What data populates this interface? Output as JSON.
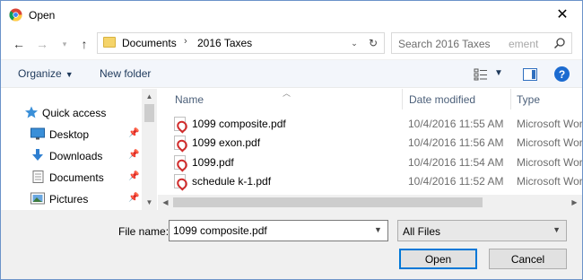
{
  "window": {
    "title": "Open"
  },
  "address": {
    "crumbs": [
      "Documents",
      "2016 Taxes"
    ]
  },
  "search": {
    "placeholder": "Search 2016 Taxes",
    "ghost_text": "ement"
  },
  "toolbar": {
    "organize_label": "Organize",
    "new_folder_label": "New folder"
  },
  "nav": {
    "items": [
      {
        "label": "Quick access",
        "icon": "star-icon"
      },
      {
        "label": "Desktop",
        "icon": "desktop-icon"
      },
      {
        "label": "Downloads",
        "icon": "download-arrow-icon"
      },
      {
        "label": "Documents",
        "icon": "documents-icon"
      },
      {
        "label": "Pictures",
        "icon": "pictures-icon"
      }
    ]
  },
  "columns": {
    "name": "Name",
    "date": "Date modified",
    "type": "Type"
  },
  "files": [
    {
      "name": "1099 composite.pdf",
      "date": "10/4/2016 11:55 AM",
      "type": "Microsoft Wor"
    },
    {
      "name": "1099 exon.pdf",
      "date": "10/4/2016 11:56 AM",
      "type": "Microsoft Wor"
    },
    {
      "name": "1099.pdf",
      "date": "10/4/2016 11:54 AM",
      "type": "Microsoft Wor"
    },
    {
      "name": "schedule k-1.pdf",
      "date": "10/4/2016 11:52 AM",
      "type": "Microsoft Wor"
    }
  ],
  "bottom": {
    "file_name_label": "File name:",
    "file_name_value": "1099 composite.pdf",
    "filter_value": "All Files",
    "open_label": "Open",
    "cancel_label": "Cancel"
  },
  "colors": {
    "accent": "#0078d7",
    "help": "#1c6bd0",
    "pdf_red": "#d12b2b",
    "folder": "#f5d46a"
  }
}
